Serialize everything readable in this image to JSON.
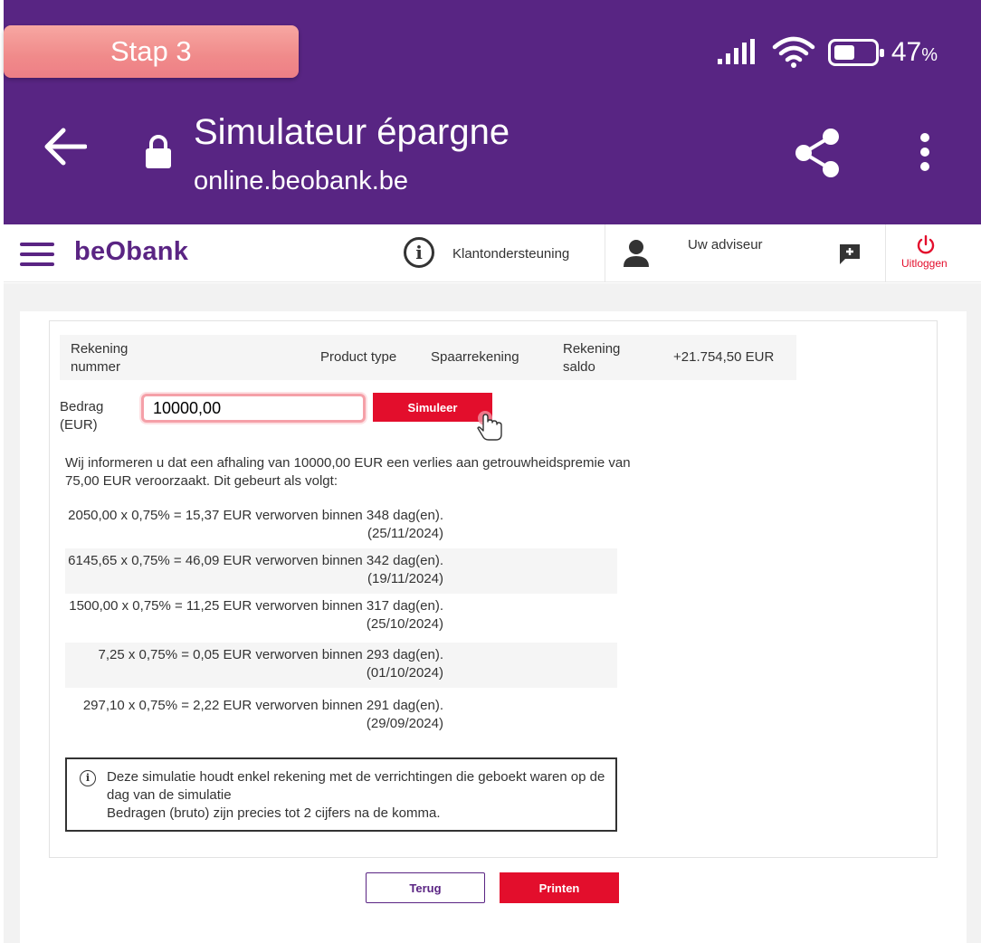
{
  "step_badge": "Stap 3",
  "status_bar": {
    "battery_percent": "47",
    "battery_unit": "%"
  },
  "browser": {
    "title": "Simulateur épargne",
    "url": "online.beobank.be"
  },
  "header": {
    "logo": "beObank",
    "support": "Klantondersteuning",
    "advisor": "Uw adviseur",
    "logout": "Uitloggen"
  },
  "account": {
    "number_label": "Rekening nummer",
    "product_type_label": "Product type",
    "product_type_value": "Spaarrekening",
    "balance_label": "Rekening saldo",
    "balance_value": "+21.754,50 EUR"
  },
  "form": {
    "amount_label": "Bedrag (EUR)",
    "amount_value": "10000,00",
    "simulate_label": "Simuleer"
  },
  "notice": "Wij informeren u dat een afhaling van 10000,00 EUR een verlies aan getrouwheidspremie van 75,00 EUR veroorzaakt. Dit gebeurt als volgt:",
  "lines": [
    {
      "text": "2050,00 x 0,75% = 15,37 EUR verworven binnen 348 dag(en). (25/11/2024)"
    },
    {
      "text": "6145,65 x 0,75% = 46,09 EUR verworven binnen 342 dag(en). (19/11/2024)"
    },
    {
      "text": "1500,00 x 0,75% = 11,25 EUR verworven binnen 317 dag(en). (25/10/2024)"
    },
    {
      "text": "7,25 x 0,75% = 0,05 EUR verworven binnen 293 dag(en). (01/10/2024)"
    },
    {
      "text": "297,10 x 0,75% = 2,22 EUR verworven binnen 291 dag(en). (29/09/2024)"
    }
  ],
  "disclaimer": {
    "line1": "Deze simulatie houdt enkel rekening met de verrichtingen die geboekt waren op de dag van de simulatie",
    "line2": "Bedragen (bruto) zijn precies tot 2 cijfers na de komma."
  },
  "buttons": {
    "back": "Terug",
    "print": "Printen"
  },
  "colors": {
    "purple": "#582583",
    "red": "#e30e2c",
    "badge": "#f08a8a"
  }
}
